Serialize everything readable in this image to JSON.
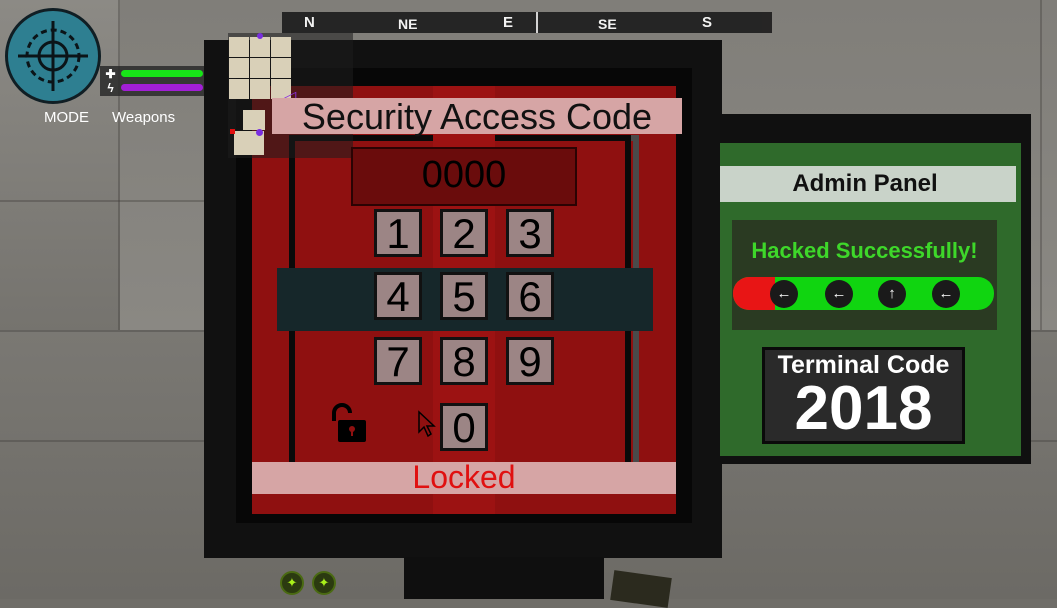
{
  "compass": {
    "n": "N",
    "ne": "NE",
    "e": "E",
    "se": "SE",
    "s": "S"
  },
  "hud": {
    "mode_label": "MODE",
    "weapons_label": "Weapons",
    "health_icon": "health-plus-icon",
    "energy_icon": "energy-bolt-icon",
    "health_color": "#18e418",
    "energy_color": "#a21fd6",
    "health_level": 1.0,
    "energy_level": 1.0
  },
  "security_panel": {
    "title": "Security Access Code",
    "code_value": "0000",
    "keys": [
      "1",
      "2",
      "3",
      "4",
      "5",
      "6",
      "7",
      "8",
      "9",
      "0"
    ],
    "status": "Locked",
    "status_color": "#e01010",
    "lock_icon": "lock-open-icon"
  },
  "admin_panel": {
    "title": "Admin Panel",
    "hack_status": "Hacked Successfully!",
    "arrows": [
      "left-arrow-icon",
      "left-arrow-icon",
      "up-arrow-icon",
      "left-arrow-icon"
    ],
    "terminal_label": "Terminal Code",
    "terminal_code": "2018"
  },
  "colors": {
    "panel_red": "#8f1010",
    "panel_green": "#2f6a2b",
    "success_green": "#3ed72a"
  }
}
